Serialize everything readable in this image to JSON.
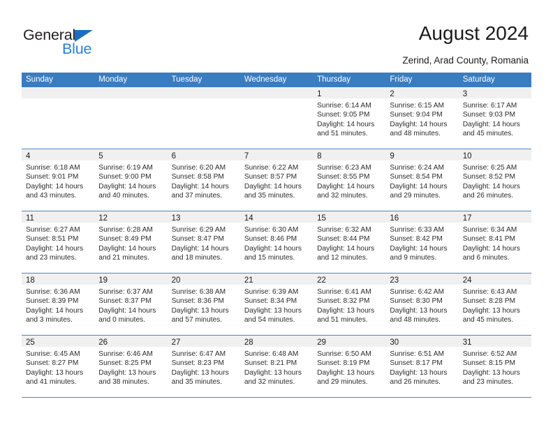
{
  "brand": {
    "name_part1": "General",
    "name_part2": "Blue",
    "triangle_color": "#1b6ec2",
    "blue_color": "#2980d9"
  },
  "header": {
    "title": "August 2024",
    "subtitle": "Zerind, Arad County, Romania"
  },
  "theme": {
    "header_row_bg": "#3a7cc0",
    "week_divider": "#4a86c5",
    "daynum_band_bg": "#f0f0f0"
  },
  "weekdays": [
    "Sunday",
    "Monday",
    "Tuesday",
    "Wednesday",
    "Thursday",
    "Friday",
    "Saturday"
  ],
  "weeks": [
    [
      {
        "day": "",
        "empty": true
      },
      {
        "day": "",
        "empty": true
      },
      {
        "day": "",
        "empty": true
      },
      {
        "day": "",
        "empty": true
      },
      {
        "day": "1",
        "sunrise": "Sunrise: 6:14 AM",
        "sunset": "Sunset: 9:05 PM",
        "daylight1": "Daylight: 14 hours",
        "daylight2": "and 51 minutes."
      },
      {
        "day": "2",
        "sunrise": "Sunrise: 6:15 AM",
        "sunset": "Sunset: 9:04 PM",
        "daylight1": "Daylight: 14 hours",
        "daylight2": "and 48 minutes."
      },
      {
        "day": "3",
        "sunrise": "Sunrise: 6:17 AM",
        "sunset": "Sunset: 9:03 PM",
        "daylight1": "Daylight: 14 hours",
        "daylight2": "and 45 minutes."
      }
    ],
    [
      {
        "day": "4",
        "sunrise": "Sunrise: 6:18 AM",
        "sunset": "Sunset: 9:01 PM",
        "daylight1": "Daylight: 14 hours",
        "daylight2": "and 43 minutes."
      },
      {
        "day": "5",
        "sunrise": "Sunrise: 6:19 AM",
        "sunset": "Sunset: 9:00 PM",
        "daylight1": "Daylight: 14 hours",
        "daylight2": "and 40 minutes."
      },
      {
        "day": "6",
        "sunrise": "Sunrise: 6:20 AM",
        "sunset": "Sunset: 8:58 PM",
        "daylight1": "Daylight: 14 hours",
        "daylight2": "and 37 minutes."
      },
      {
        "day": "7",
        "sunrise": "Sunrise: 6:22 AM",
        "sunset": "Sunset: 8:57 PM",
        "daylight1": "Daylight: 14 hours",
        "daylight2": "and 35 minutes."
      },
      {
        "day": "8",
        "sunrise": "Sunrise: 6:23 AM",
        "sunset": "Sunset: 8:55 PM",
        "daylight1": "Daylight: 14 hours",
        "daylight2": "and 32 minutes."
      },
      {
        "day": "9",
        "sunrise": "Sunrise: 6:24 AM",
        "sunset": "Sunset: 8:54 PM",
        "daylight1": "Daylight: 14 hours",
        "daylight2": "and 29 minutes."
      },
      {
        "day": "10",
        "sunrise": "Sunrise: 6:25 AM",
        "sunset": "Sunset: 8:52 PM",
        "daylight1": "Daylight: 14 hours",
        "daylight2": "and 26 minutes."
      }
    ],
    [
      {
        "day": "11",
        "sunrise": "Sunrise: 6:27 AM",
        "sunset": "Sunset: 8:51 PM",
        "daylight1": "Daylight: 14 hours",
        "daylight2": "and 23 minutes."
      },
      {
        "day": "12",
        "sunrise": "Sunrise: 6:28 AM",
        "sunset": "Sunset: 8:49 PM",
        "daylight1": "Daylight: 14 hours",
        "daylight2": "and 21 minutes."
      },
      {
        "day": "13",
        "sunrise": "Sunrise: 6:29 AM",
        "sunset": "Sunset: 8:47 PM",
        "daylight1": "Daylight: 14 hours",
        "daylight2": "and 18 minutes."
      },
      {
        "day": "14",
        "sunrise": "Sunrise: 6:30 AM",
        "sunset": "Sunset: 8:46 PM",
        "daylight1": "Daylight: 14 hours",
        "daylight2": "and 15 minutes."
      },
      {
        "day": "15",
        "sunrise": "Sunrise: 6:32 AM",
        "sunset": "Sunset: 8:44 PM",
        "daylight1": "Daylight: 14 hours",
        "daylight2": "and 12 minutes."
      },
      {
        "day": "16",
        "sunrise": "Sunrise: 6:33 AM",
        "sunset": "Sunset: 8:42 PM",
        "daylight1": "Daylight: 14 hours",
        "daylight2": "and 9 minutes."
      },
      {
        "day": "17",
        "sunrise": "Sunrise: 6:34 AM",
        "sunset": "Sunset: 8:41 PM",
        "daylight1": "Daylight: 14 hours",
        "daylight2": "and 6 minutes."
      }
    ],
    [
      {
        "day": "18",
        "sunrise": "Sunrise: 6:36 AM",
        "sunset": "Sunset: 8:39 PM",
        "daylight1": "Daylight: 14 hours",
        "daylight2": "and 3 minutes."
      },
      {
        "day": "19",
        "sunrise": "Sunrise: 6:37 AM",
        "sunset": "Sunset: 8:37 PM",
        "daylight1": "Daylight: 14 hours",
        "daylight2": "and 0 minutes."
      },
      {
        "day": "20",
        "sunrise": "Sunrise: 6:38 AM",
        "sunset": "Sunset: 8:36 PM",
        "daylight1": "Daylight: 13 hours",
        "daylight2": "and 57 minutes."
      },
      {
        "day": "21",
        "sunrise": "Sunrise: 6:39 AM",
        "sunset": "Sunset: 8:34 PM",
        "daylight1": "Daylight: 13 hours",
        "daylight2": "and 54 minutes."
      },
      {
        "day": "22",
        "sunrise": "Sunrise: 6:41 AM",
        "sunset": "Sunset: 8:32 PM",
        "daylight1": "Daylight: 13 hours",
        "daylight2": "and 51 minutes."
      },
      {
        "day": "23",
        "sunrise": "Sunrise: 6:42 AM",
        "sunset": "Sunset: 8:30 PM",
        "daylight1": "Daylight: 13 hours",
        "daylight2": "and 48 minutes."
      },
      {
        "day": "24",
        "sunrise": "Sunrise: 6:43 AM",
        "sunset": "Sunset: 8:28 PM",
        "daylight1": "Daylight: 13 hours",
        "daylight2": "and 45 minutes."
      }
    ],
    [
      {
        "day": "25",
        "sunrise": "Sunrise: 6:45 AM",
        "sunset": "Sunset: 8:27 PM",
        "daylight1": "Daylight: 13 hours",
        "daylight2": "and 41 minutes."
      },
      {
        "day": "26",
        "sunrise": "Sunrise: 6:46 AM",
        "sunset": "Sunset: 8:25 PM",
        "daylight1": "Daylight: 13 hours",
        "daylight2": "and 38 minutes."
      },
      {
        "day": "27",
        "sunrise": "Sunrise: 6:47 AM",
        "sunset": "Sunset: 8:23 PM",
        "daylight1": "Daylight: 13 hours",
        "daylight2": "and 35 minutes."
      },
      {
        "day": "28",
        "sunrise": "Sunrise: 6:48 AM",
        "sunset": "Sunset: 8:21 PM",
        "daylight1": "Daylight: 13 hours",
        "daylight2": "and 32 minutes."
      },
      {
        "day": "29",
        "sunrise": "Sunrise: 6:50 AM",
        "sunset": "Sunset: 8:19 PM",
        "daylight1": "Daylight: 13 hours",
        "daylight2": "and 29 minutes."
      },
      {
        "day": "30",
        "sunrise": "Sunrise: 6:51 AM",
        "sunset": "Sunset: 8:17 PM",
        "daylight1": "Daylight: 13 hours",
        "daylight2": "and 26 minutes."
      },
      {
        "day": "31",
        "sunrise": "Sunrise: 6:52 AM",
        "sunset": "Sunset: 8:15 PM",
        "daylight1": "Daylight: 13 hours",
        "daylight2": "and 23 minutes."
      }
    ]
  ]
}
